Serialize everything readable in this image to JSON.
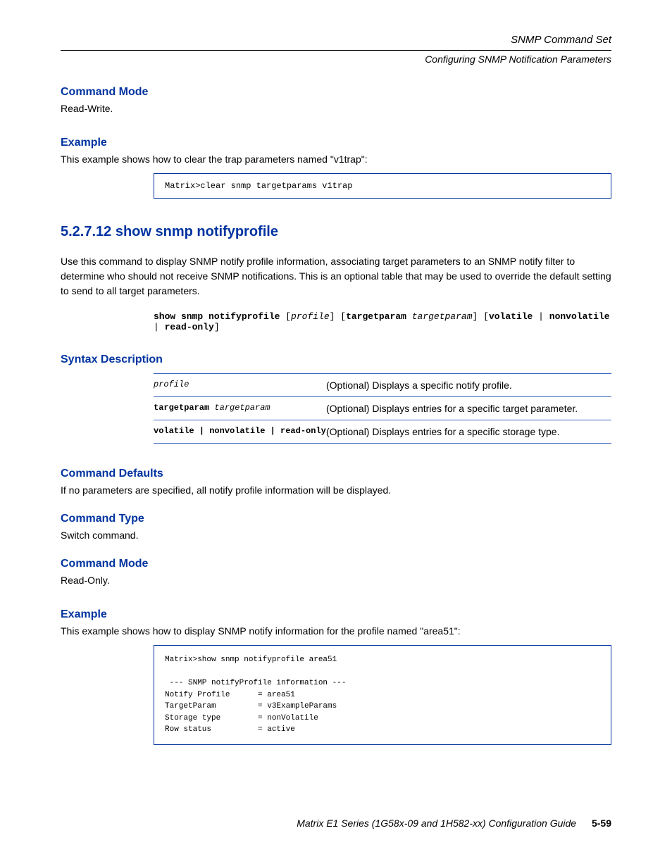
{
  "header": {
    "title": "SNMP Command Set",
    "subtitle": "Configuring SNMP Notification Parameters"
  },
  "s1": {
    "command_mode": {
      "heading": "Command Mode",
      "body": "Read-Write."
    },
    "example": {
      "heading": "Example",
      "body": "This example shows how to clear the trap parameters named \"v1trap\":",
      "code": "Matrix>clear snmp targetparams v1trap"
    }
  },
  "main": {
    "heading": "5.2.7.12  show snmp notifyprofile",
    "intro": "Use this command to display SNMP notify profile information, associating target parameters to an SNMP notify filter to determine who should not receive SNMP notifications. This is an optional table that may be used to override the default setting to send to all target parameters.",
    "syntax_cmd": "show snmp notifyprofile [profile] [targetparam targetparam] [volatile | nonvolatile | read-only]"
  },
  "syntax_desc": {
    "heading": "Syntax Description",
    "rows": [
      {
        "param": "profile",
        "desc": "(Optional) Displays a specific notify profile."
      },
      {
        "param": "targetparam targetparam",
        "desc": "(Optional) Displays entries for a specific target parameter."
      },
      {
        "param": "volatile | nonvolatile | read-only",
        "desc": "(Optional) Displays entries for a specific storage type."
      }
    ]
  },
  "s2": {
    "command_defaults": {
      "heading": "Command Defaults",
      "body": "If no parameters are specified, all notify profile information will be displayed."
    },
    "command_type": {
      "heading": "Command Type",
      "body": "Switch command."
    },
    "command_mode": {
      "heading": "Command Mode",
      "body": "Read-Only."
    },
    "example": {
      "heading": "Example",
      "body": "This example shows how to display SNMP notify information for the profile named \"area51\":",
      "code": "Matrix>show snmp notifyprofile area51\n\n --- SNMP notifyProfile information ---\nNotify Profile      = area51\nTargetParam         = v3ExampleParams\nStorage type        = nonVolatile\nRow status          = active"
    }
  },
  "footer": {
    "text": "Matrix E1 Series (1G58x-09 and 1H582-xx) Configuration Guide",
    "page": "5-59"
  }
}
